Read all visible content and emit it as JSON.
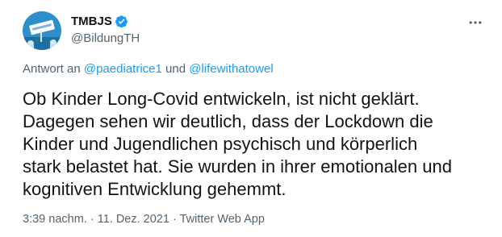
{
  "author": {
    "display_name": "TMBJS",
    "handle": "@BildungTH",
    "verified": true,
    "avatar_icon": "avatar-protest-sign-icon"
  },
  "more_menu_icon": "more-dots-icon",
  "reply_to": {
    "prefix": "Antwort an",
    "mention_1": "@paediatrice1",
    "conjunction": "und",
    "mention_2": "@lifewithatowel"
  },
  "tweet_text_lines": [
    "Ob Kinder Long-Covid entwickeln, ist nicht geklärt.",
    "Dagegen sehen wir deutlich, dass der Lockdown die",
    "Kinder und Jugendlichen psychisch und körperlich",
    "stark belastet hat. Sie wurden in ihrer emotionalen und",
    "kognitiven Entwicklung gehemmt."
  ],
  "meta": {
    "time": "3:39 nachm.",
    "separator": "·",
    "date": "11. Dez. 2021",
    "source": "Twitter Web App"
  },
  "colors": {
    "link": "#1d9bf0",
    "secondary_text": "#536471",
    "primary_text": "#0f1419",
    "verified_badge": "#1d9bf0"
  }
}
